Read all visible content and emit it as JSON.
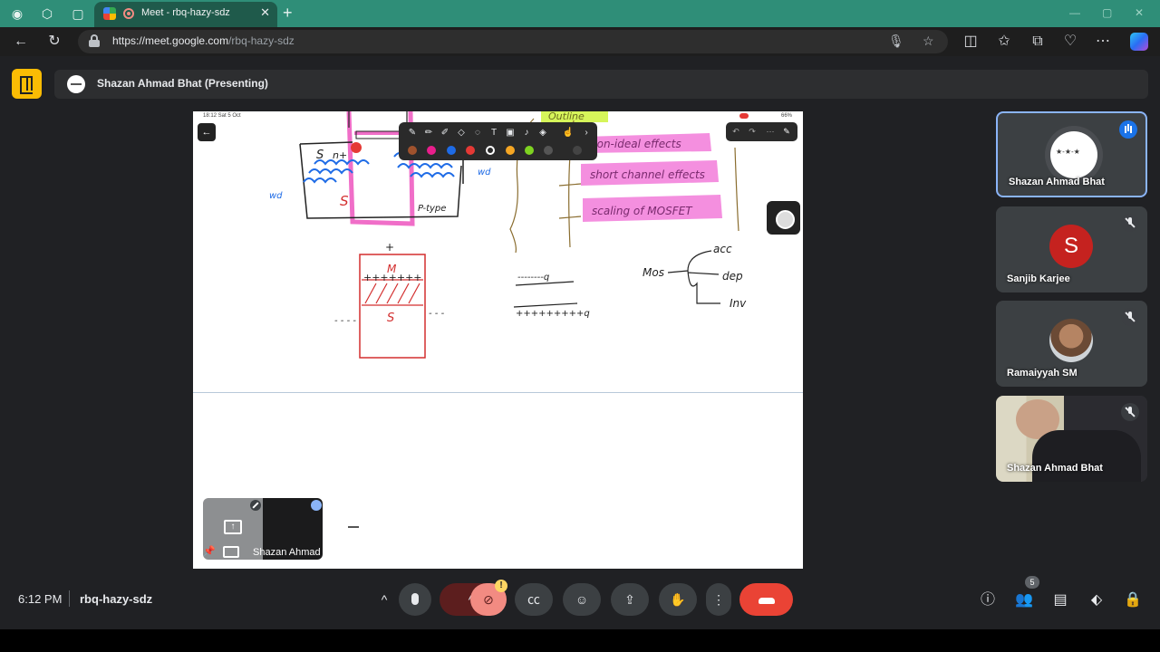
{
  "browser": {
    "tab_title": "Meet - rbq-hazy-sdz",
    "url_host": "https://meet.google.com",
    "url_path": "/rbq-hazy-sdz"
  },
  "meet": {
    "presenter_banner": "Shazan Ahmad Bhat (Presenting)",
    "clock": "6:12 PM",
    "meeting_code": "rbq-hazy-sdz",
    "participant_count": "5",
    "camera_warning": "!"
  },
  "screen": {
    "status_time": "18:12  Sat 5 Oct",
    "status_battery": "66%",
    "pen_colors": [
      "#a0522d",
      "#e91e8c",
      "#1e6be6",
      "#e53935",
      "#ffffff",
      "#f5a623",
      "#7ed321"
    ],
    "notes": {
      "heading": "Outline",
      "item1": "non-ideal effects",
      "item2": "short channel effects",
      "item3": "scaling of MOSFET",
      "s_label": "S",
      "n_label": "n+",
      "wd_left": "wd",
      "wd_right": "wd",
      "ptype": "P-type",
      "plus": "+",
      "m_label": "M",
      "plus_row": "+++++++",
      "s_label2": "S",
      "dash_left": "- - - -",
      "dash_right": "- - -",
      "neg_q": "--------q",
      "pos_q": "+++++++++q",
      "mos": "Mos",
      "acc": "acc",
      "dep": "dep",
      "inv": "Inv"
    }
  },
  "self_view": {
    "name": "Shazan Ahmad Bhat"
  },
  "participants": [
    {
      "name": "Shazan Ahmad Bhat",
      "type": "logo",
      "speaking": true
    },
    {
      "name": "Sanjib Karjee",
      "type": "letter",
      "letter": "S"
    },
    {
      "name": "Ramaiyyah SM",
      "type": "photo"
    },
    {
      "name": "Shazan Ahmad Bhat",
      "type": "camera"
    }
  ]
}
